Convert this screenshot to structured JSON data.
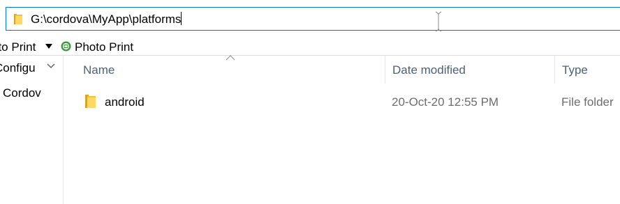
{
  "address_bar": {
    "path": "G:\\cordova\\MyApp\\platforms"
  },
  "favorites_bar": {
    "items": [
      {
        "label": "oto Print",
        "icon": "chevron-down-icon"
      },
      {
        "label": "Photo Print",
        "icon": "photo-print-icon"
      }
    ]
  },
  "nav_pane": {
    "items": [
      {
        "label": "Configu"
      },
      {
        "label": "Cordov"
      }
    ]
  },
  "file_list": {
    "columns": [
      {
        "label": "Name"
      },
      {
        "label": "Date modified"
      },
      {
        "label": "Type"
      }
    ],
    "rows": [
      {
        "name": "android",
        "date_modified": "20-Oct-20 12:55 PM",
        "type": "File folder"
      }
    ]
  },
  "colors": {
    "accent": "#0078d7",
    "folder": "#ffd866",
    "header_text": "#4c607a",
    "secondary_text": "#6d6d6d"
  }
}
